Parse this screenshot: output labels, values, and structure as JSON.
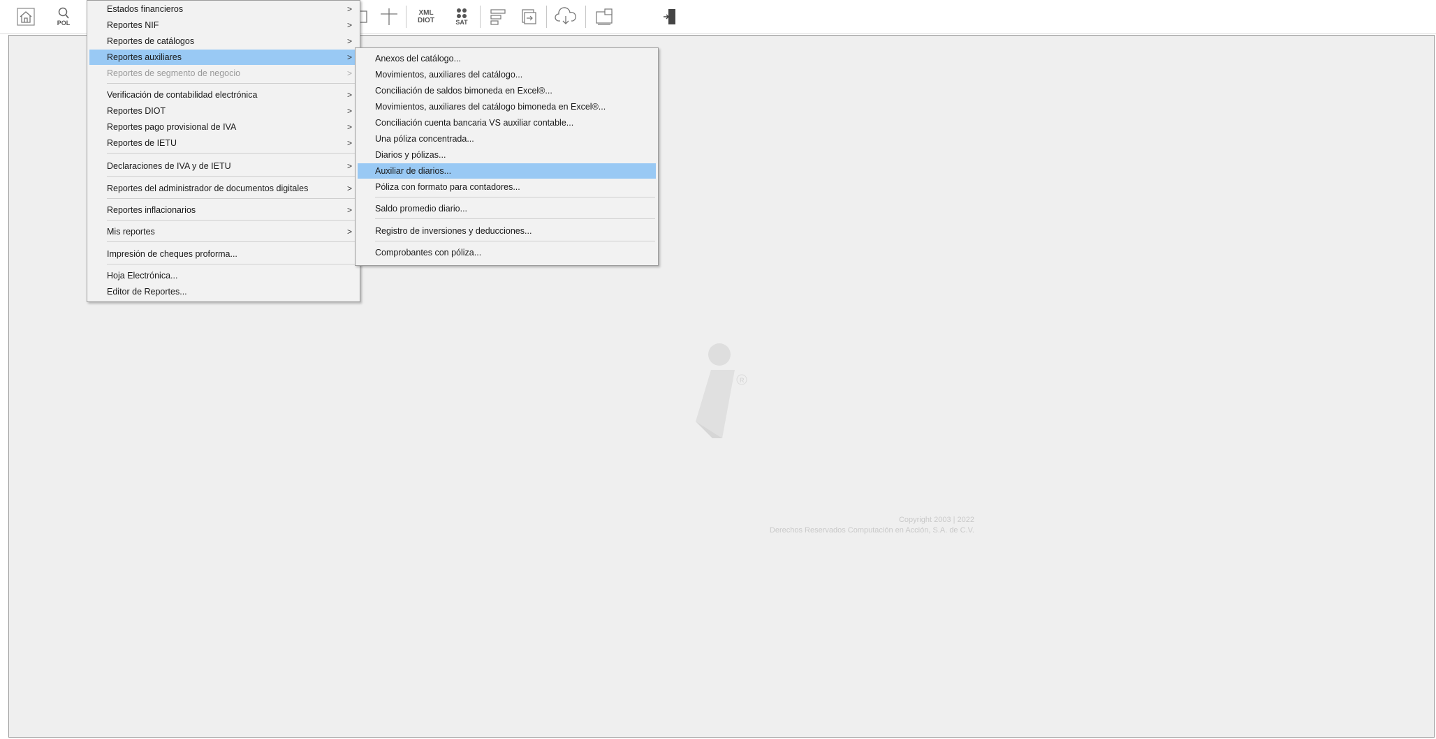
{
  "toolbar": {
    "buttons": [
      {
        "icon": "home-icon",
        "label": ""
      },
      {
        "icon": "search-icon",
        "label": "POL"
      },
      {
        "icon": "xml-diot-icon",
        "label_top": "XML",
        "label_bottom": "DIOT"
      },
      {
        "icon": "sat-icon",
        "label": "SAT"
      }
    ]
  },
  "main_menu": {
    "items": [
      {
        "label": "Estados financieros",
        "arrow": ">"
      },
      {
        "label": "Reportes NIF",
        "arrow": ">"
      },
      {
        "label": "Reportes de catálogos",
        "arrow": ">"
      },
      {
        "label": "Reportes auxiliares",
        "arrow": ">",
        "highlighted": true
      },
      {
        "label": "Reportes de segmento de negocio",
        "arrow": ">",
        "disabled": true
      },
      {
        "label": "Verificación de contabilidad electrónica",
        "arrow": ">"
      },
      {
        "label": "Reportes DIOT",
        "arrow": ">"
      },
      {
        "label": "Reportes pago provisional de IVA",
        "arrow": ">"
      },
      {
        "label": "Reportes de IETU",
        "arrow": ">"
      },
      {
        "label": "Declaraciones de IVA y de IETU",
        "arrow": ">"
      },
      {
        "label": "Reportes del administrador de documentos digitales",
        "arrow": ">"
      },
      {
        "label": "Reportes inflacionarios",
        "arrow": ">"
      },
      {
        "label": "Mis reportes",
        "arrow": ">"
      },
      {
        "label": "Impresión de cheques proforma..."
      },
      {
        "label": "Hoja Electrónica..."
      },
      {
        "label": "Editor de Reportes..."
      }
    ]
  },
  "submenu": {
    "items": [
      {
        "label": "Anexos del catálogo..."
      },
      {
        "label": "Movimientos, auxiliares del catálogo..."
      },
      {
        "label": "Conciliación de saldos bimoneda en Excel®..."
      },
      {
        "label": "Movimientos, auxiliares del catálogo bimoneda en Excel®..."
      },
      {
        "label": "Conciliación cuenta bancaria VS auxiliar contable..."
      },
      {
        "label": "Una póliza concentrada..."
      },
      {
        "label": "Diarios y pólizas..."
      },
      {
        "label": "Auxiliar de diarios...",
        "highlighted": true
      },
      {
        "label": "Póliza con formato para contadores..."
      },
      {
        "label": "Saldo promedio diario..."
      },
      {
        "label": "Registro de inversiones y deducciones..."
      },
      {
        "label": "Comprobantes con póliza..."
      }
    ]
  },
  "footer": {
    "copyright_line1": "Copyright 2003 | 2022",
    "copyright_line2": "Derechos Reservados Computación en Acción, S.A. de C.V."
  },
  "colors": {
    "highlight": "#99c9f4",
    "workspace": "#efefef",
    "menu_bg": "#f2f2f2"
  }
}
